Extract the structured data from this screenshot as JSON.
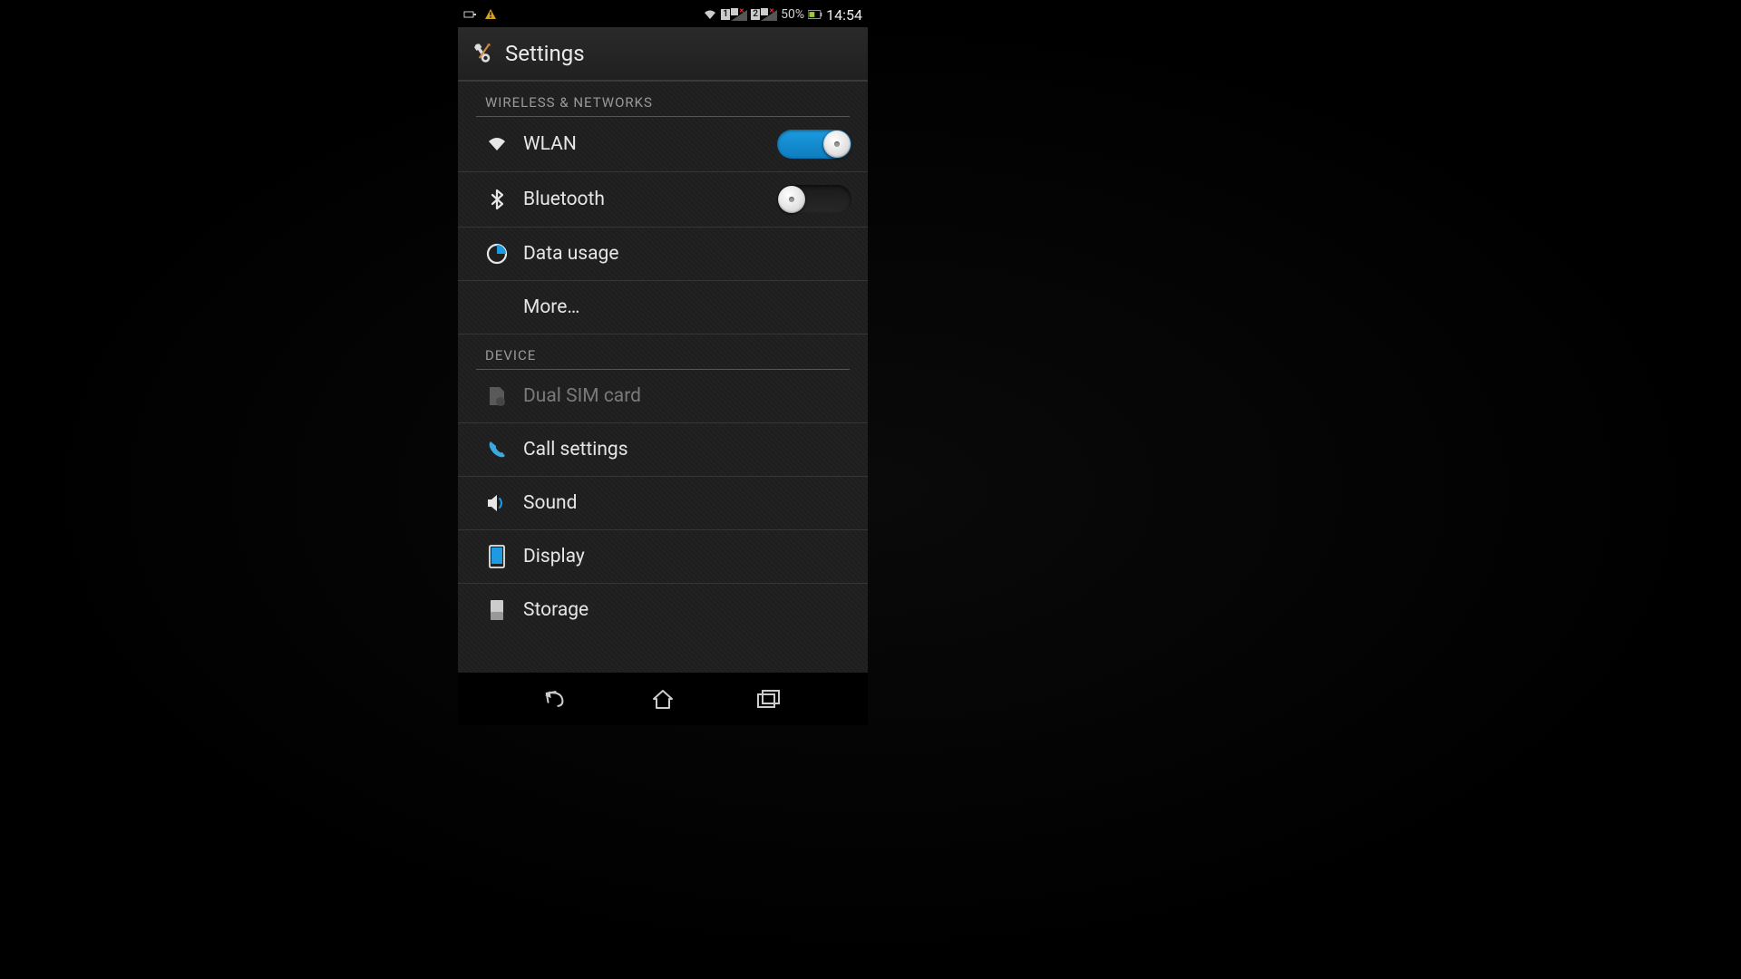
{
  "status_bar": {
    "battery_percent": "50%",
    "clock": "14:54",
    "sim1": "1",
    "sim2": "2"
  },
  "header": {
    "title": "Settings"
  },
  "sections": {
    "wireless": {
      "label": "WIRELESS & NETWORKS",
      "items": {
        "wlan": {
          "label": "WLAN",
          "toggle": true
        },
        "bluetooth": {
          "label": "Bluetooth",
          "toggle": false
        },
        "data_usage": {
          "label": "Data usage"
        },
        "more": {
          "label": "More…"
        }
      }
    },
    "device": {
      "label": "DEVICE",
      "items": {
        "dual_sim": {
          "label": "Dual SIM card",
          "disabled": true
        },
        "call_settings": {
          "label": "Call settings"
        },
        "sound": {
          "label": "Sound"
        },
        "display": {
          "label": "Display"
        },
        "storage": {
          "label": "Storage"
        }
      }
    }
  }
}
